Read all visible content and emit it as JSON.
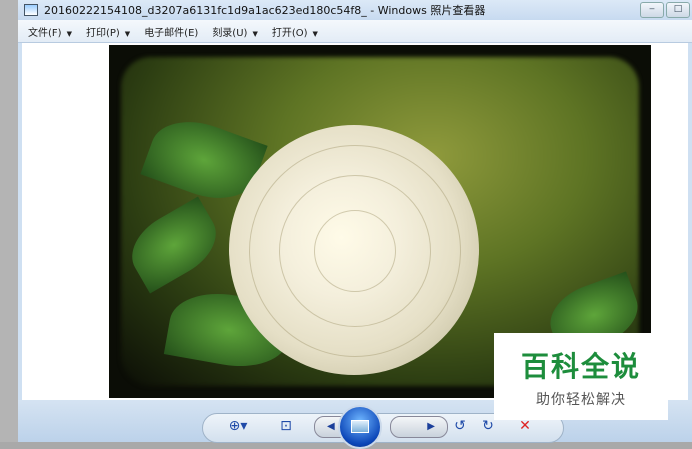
{
  "window": {
    "title": "20160222154108_d3207a6131fc1d9a1ac623ed180c54f8_ - Windows 照片查看器"
  },
  "menu": [
    {
      "label": "文件(F)",
      "dropdown": true
    },
    {
      "label": "打印(P)",
      "dropdown": true
    },
    {
      "label": "电子邮件(E)",
      "dropdown": false
    },
    {
      "label": "刻录(U)",
      "dropdown": true
    },
    {
      "label": "打开(O)",
      "dropdown": true
    }
  ],
  "toolbar": {
    "zoom": "zoom-icon",
    "actual_size": "fit-icon",
    "previous": "previous-icon",
    "slideshow": "slideshow-icon",
    "next": "next-icon",
    "rotate_ccw": "rotate-ccw-icon",
    "rotate_cw": "rotate-cw-icon",
    "delete": "delete-icon"
  },
  "watermark": {
    "line1": "百科全说",
    "line2": "助你轻松解决"
  }
}
